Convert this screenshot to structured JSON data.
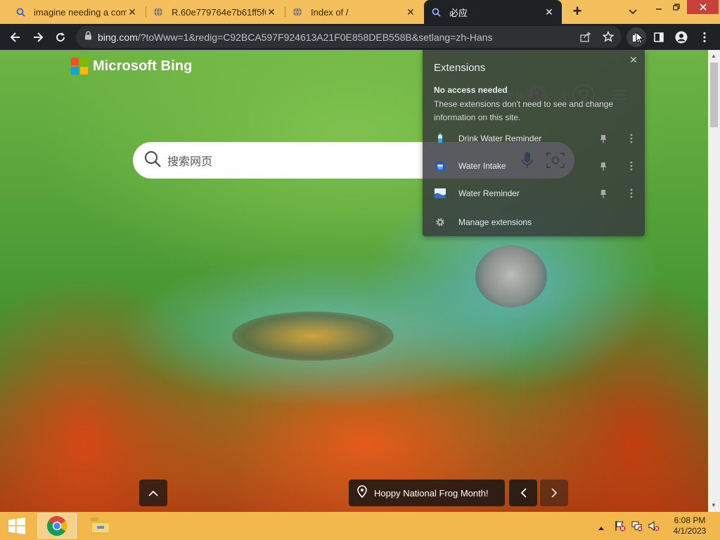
{
  "tabs": [
    {
      "title": "imagine needing a comp",
      "favicon": "search-icon",
      "active": false
    },
    {
      "title": "R.60e779764e7b61ff5f60",
      "favicon": "globe-icon",
      "active": false
    },
    {
      "title": "Index of /",
      "favicon": "globe-icon",
      "active": false
    },
    {
      "title": "必应",
      "favicon": "search-icon",
      "active": true
    }
  ],
  "toolbar": {
    "url_host": "bing.com",
    "url_rest": "/?toWww=1&redig=C92BCA597F924613A21F0E858DEB558B&setlang=zh-Hans"
  },
  "page": {
    "logo_text": "Microsoft Bing",
    "logo_colors": [
      "#f25022",
      "#7fba00",
      "#00a4ef",
      "#ffb900"
    ],
    "search_placeholder": "搜索网页",
    "header_faint": {
      "signin": "登录",
      "points": "5"
    },
    "caption": "Hoppy National Frog Month!"
  },
  "extensions_popup": {
    "title": "Extensions",
    "section_title": "No access needed",
    "section_desc": "These extensions don't need to see and change information on this site.",
    "items": [
      {
        "name": "Drink Water Reminder",
        "icon": "water-bottle-icon"
      },
      {
        "name": "Water Intake",
        "icon": "water-glass-icon"
      },
      {
        "name": "Water Reminder",
        "icon": "water-wave-icon"
      }
    ],
    "manage_label": "Manage extensions"
  },
  "taskbar": {
    "time": "6:08 PM",
    "date": "4/1/2023"
  },
  "colors": {
    "tab_strip": "#f4c05e",
    "toolbar": "#202124",
    "taskbar": "#f2b84d"
  }
}
